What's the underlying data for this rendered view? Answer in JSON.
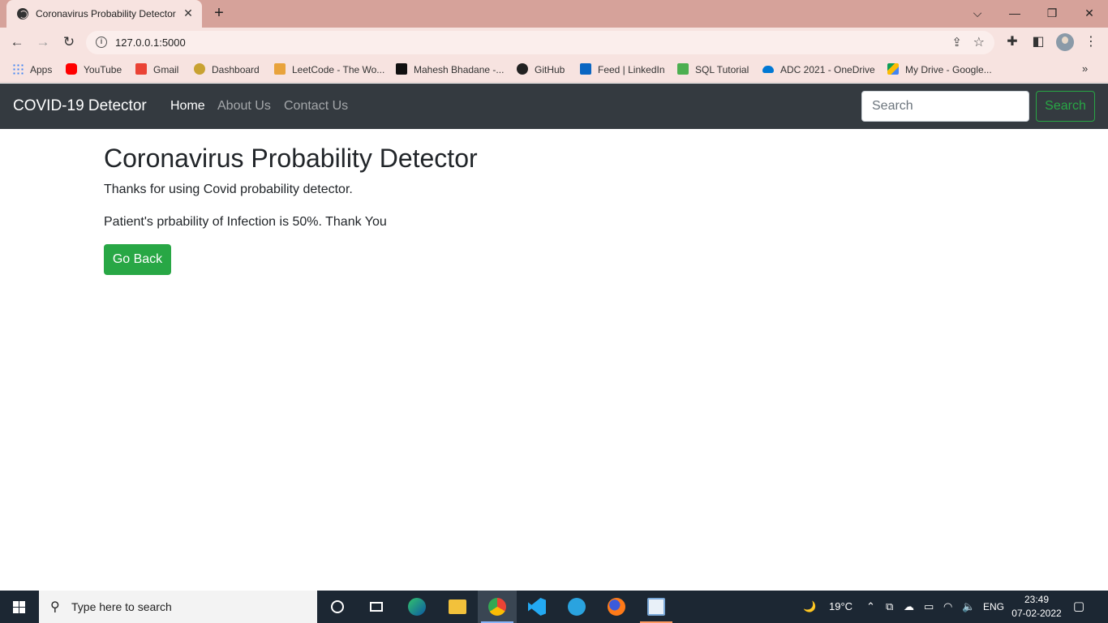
{
  "browser": {
    "tab_title": "Coronavirus Probability Detector",
    "tab_close": "✕",
    "new_tab": "+",
    "url": "127.0.0.1:5000",
    "window_controls": {
      "dropdown": "⌵",
      "minimize": "—",
      "restore": "❐",
      "close": "✕"
    }
  },
  "bookmarks": [
    {
      "label": "Apps",
      "color": "#4285f4"
    },
    {
      "label": "YouTube",
      "color": "#ff0000"
    },
    {
      "label": "Gmail",
      "color": "#ea4335"
    },
    {
      "label": "Dashboard",
      "color": "#c8a232"
    },
    {
      "label": "LeetCode - The Wo...",
      "color": "#e8a33c"
    },
    {
      "label": "Mahesh Bhadane -...",
      "color": "#111111"
    },
    {
      "label": "GitHub",
      "color": "#222222"
    },
    {
      "label": "Feed | LinkedIn",
      "color": "#0a66c2"
    },
    {
      "label": "SQL Tutorial",
      "color": "#4caf50"
    },
    {
      "label": "ADC 2021 - OneDrive",
      "color": "#0078d4"
    },
    {
      "label": "My Drive - Google...",
      "color": "#fbbc04"
    }
  ],
  "bookmarks_more": "»",
  "site_nav": {
    "brand": "COVID-19 Detector",
    "links": [
      "Home",
      "About Us",
      "Contact Us"
    ],
    "search_placeholder": "Search",
    "search_button": "Search"
  },
  "main": {
    "heading": "Coronavirus Probability Detector",
    "thanks": "Thanks for using Covid probability detector.",
    "result": "Patient's prbability of Infection is 50%. Thank You",
    "go_back": "Go Back"
  },
  "taskbar": {
    "search_placeholder": "Type here to search",
    "temperature": "19°C",
    "language": "ENG",
    "time": "23:49",
    "date": "07-02-2022"
  },
  "colors": {
    "tab_strip": "#d6a29a",
    "toolbar": "#f7e3e0",
    "navbar": "#343a40",
    "success": "#28a745",
    "taskbar": "#1c2733"
  }
}
